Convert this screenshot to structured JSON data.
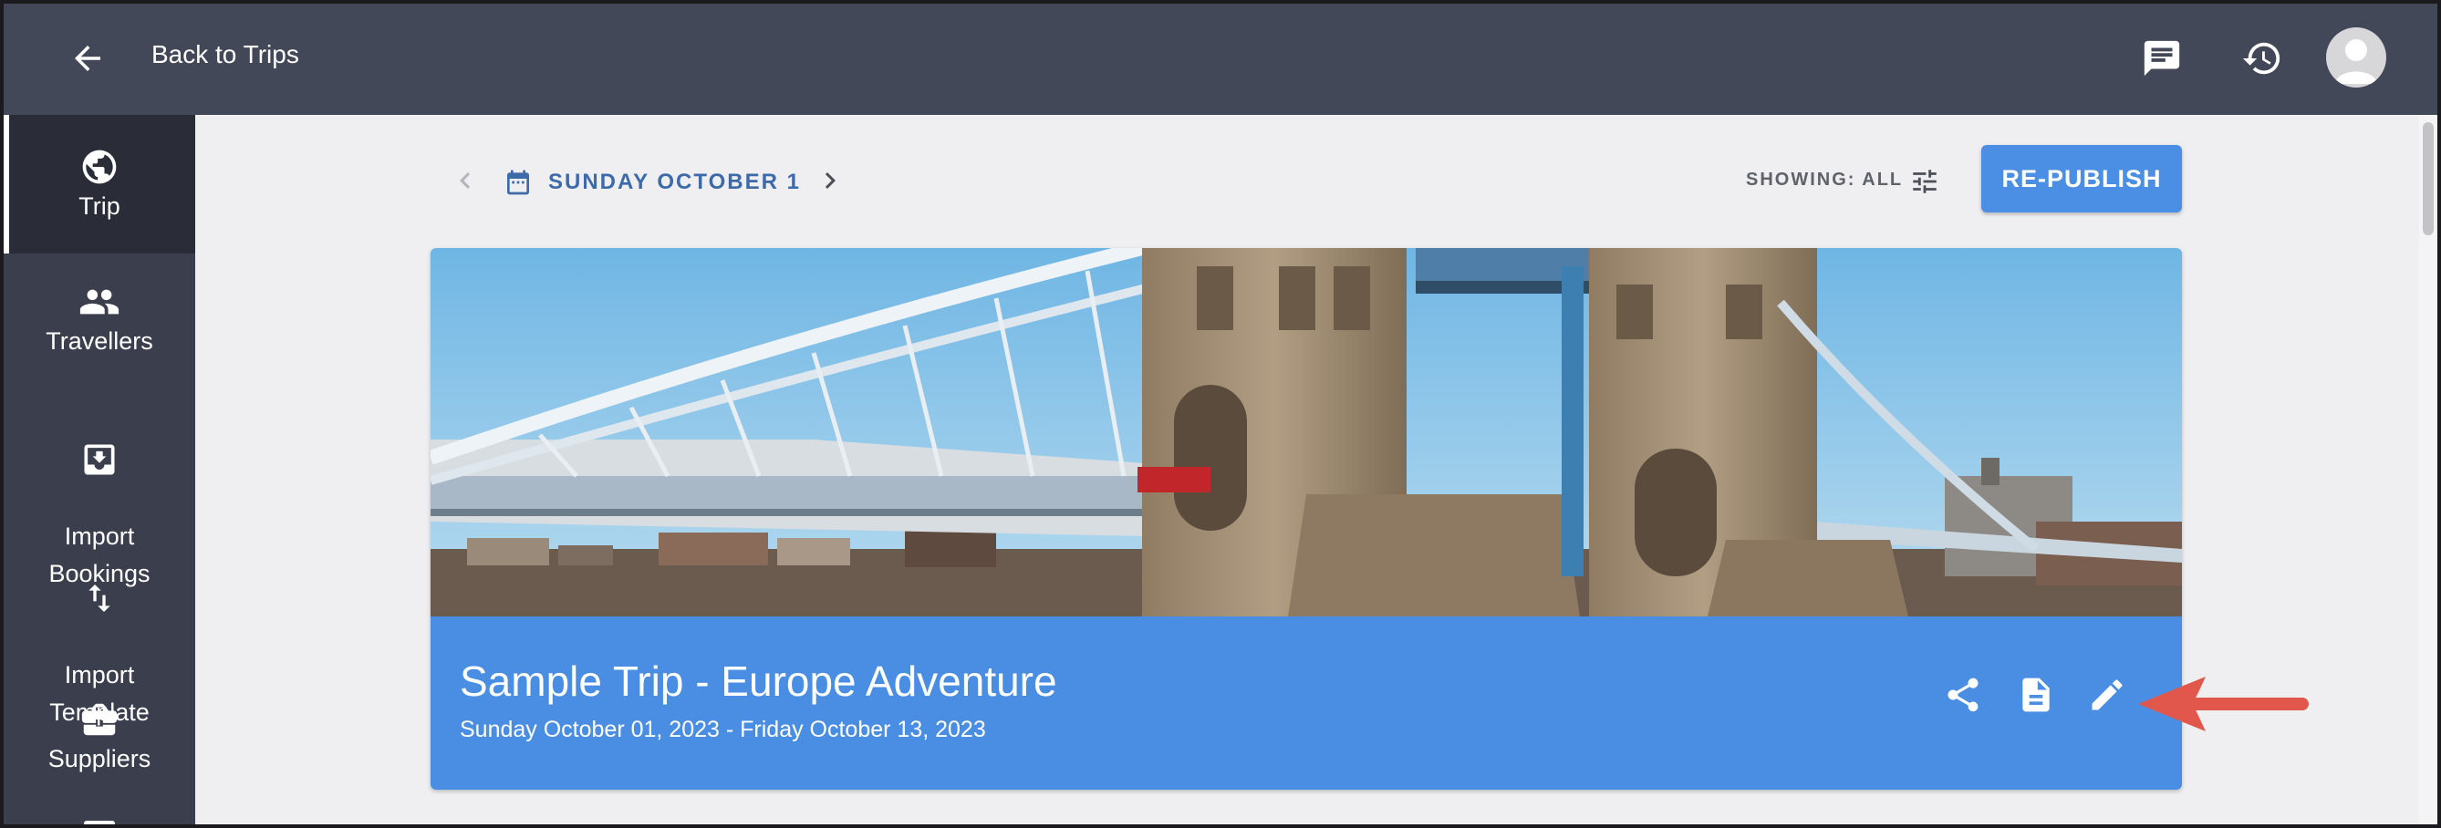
{
  "header": {
    "back_label": "Back to Trips",
    "icons": [
      "arrow-back-icon",
      "chat-icon",
      "history-icon",
      "avatar"
    ]
  },
  "sidebar": {
    "items": [
      {
        "label": "Trip",
        "icon": "globe-icon",
        "active": true
      },
      {
        "label": "Travellers",
        "icon": "people-icon"
      },
      {
        "label": "Import\nBookings",
        "icon": "download-box-icon"
      },
      {
        "label": "Import\nTemplate",
        "icon": "swap-vert-icon"
      },
      {
        "label": "Suppliers",
        "icon": "briefcase-icon"
      }
    ]
  },
  "date_nav": {
    "label": "SUNDAY OCTOBER 1"
  },
  "filter": {
    "showing_label": "SHOWING: ALL"
  },
  "republish_label": "RE-PUBLISH",
  "trip": {
    "title": "Sample Trip - Europe Adventure",
    "dates": "Sunday October 01, 2023 - Friday October 13, 2023"
  },
  "colors": {
    "topbar": "#434858",
    "sidebar": "#3b3f4d",
    "accent": "#4a8fe3",
    "date_text": "#3d6aa9",
    "annotation_arrow": "#e2574c"
  }
}
